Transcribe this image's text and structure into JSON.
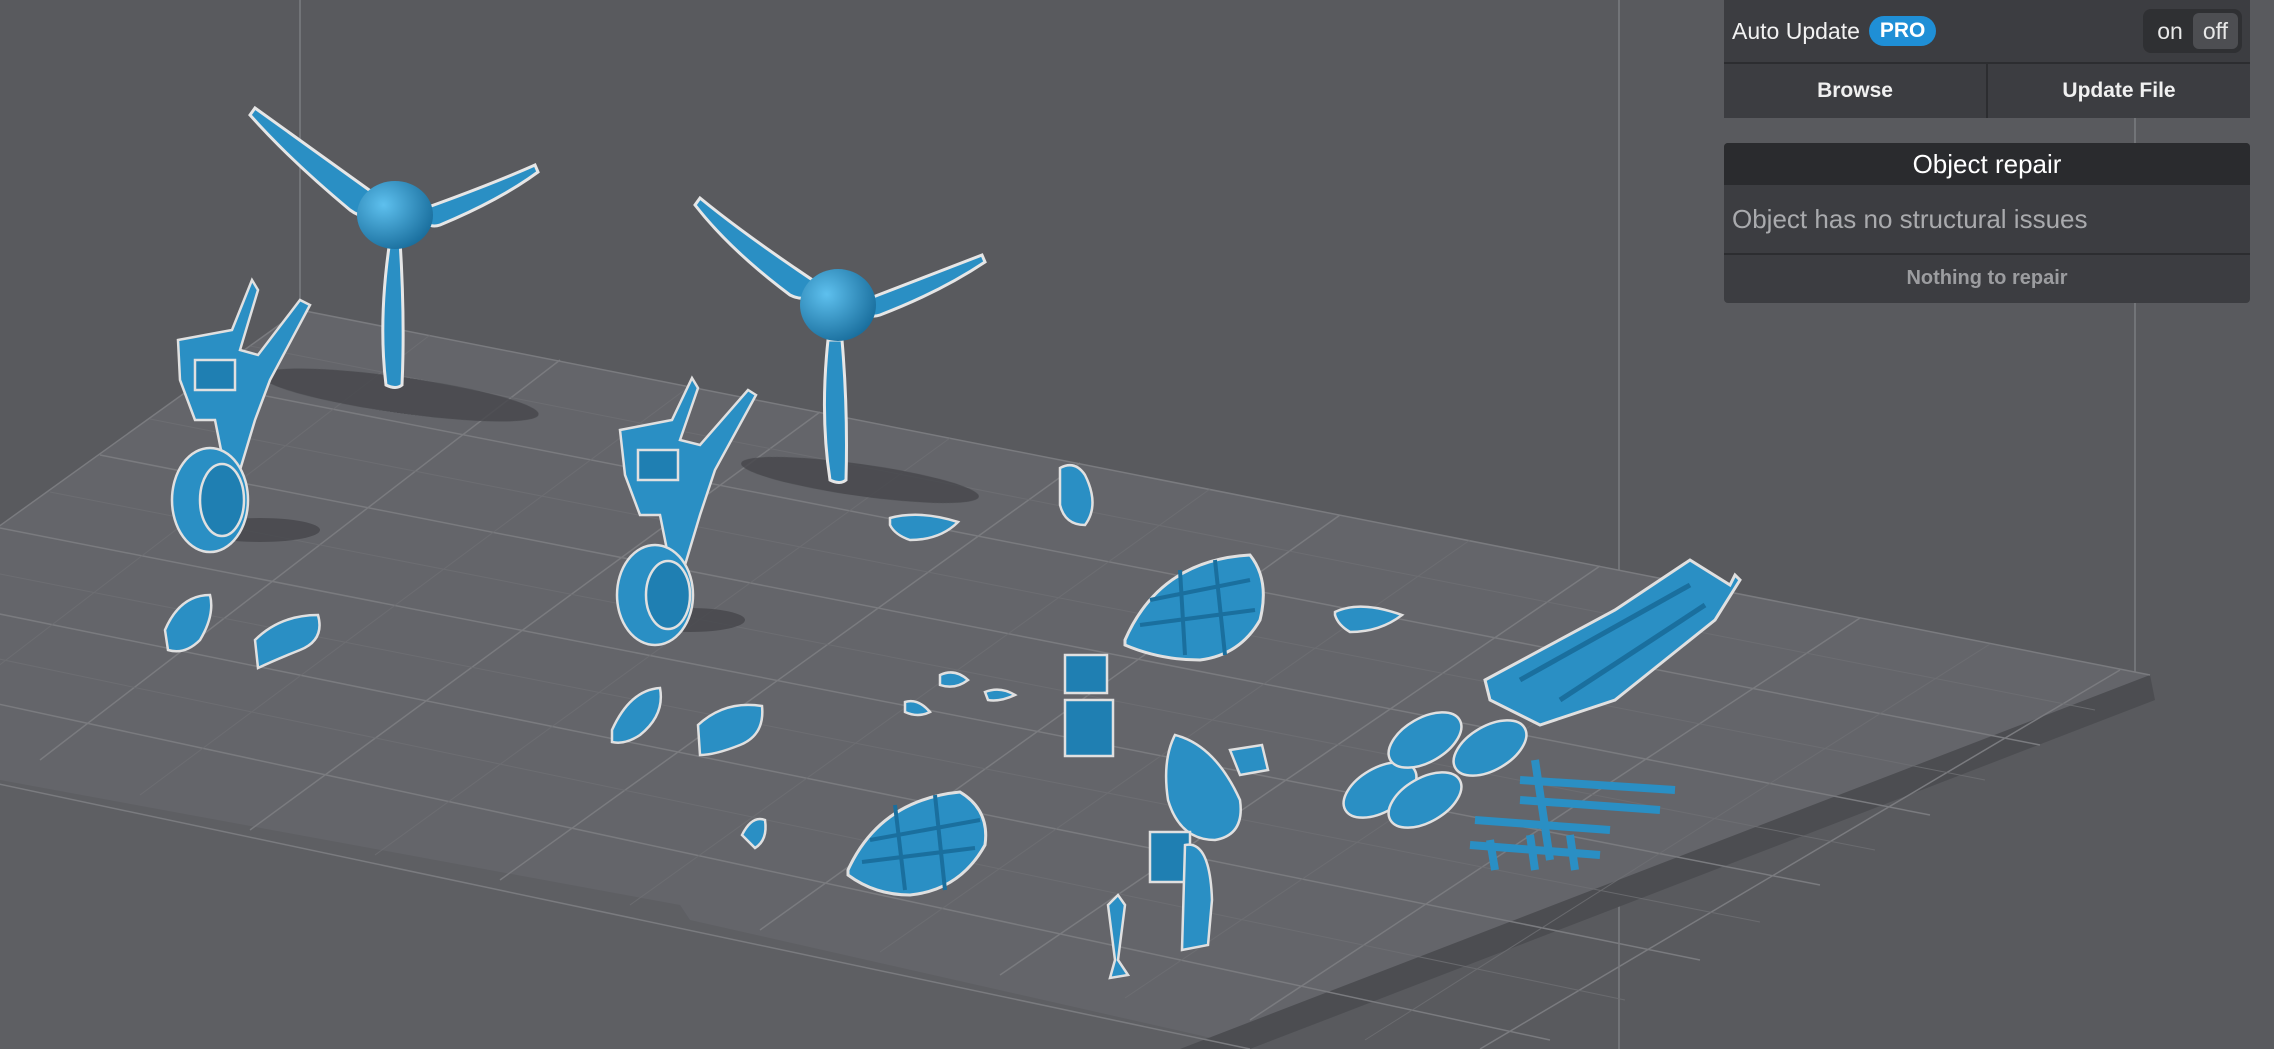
{
  "auto_update": {
    "label": "Auto Update",
    "badge": "PRO",
    "toggle_on": "on",
    "toggle_off": "off",
    "selected": "off"
  },
  "file_actions": {
    "browse": "Browse",
    "update_file": "Update File"
  },
  "object_repair": {
    "title": "Object repair",
    "message": "Object has no structural issues",
    "button": "Nothing to repair"
  },
  "colors": {
    "background": "#595a5e",
    "model": "#2a8fc4",
    "grid": "#7a7b7f",
    "accent": "#1f8fd6"
  }
}
